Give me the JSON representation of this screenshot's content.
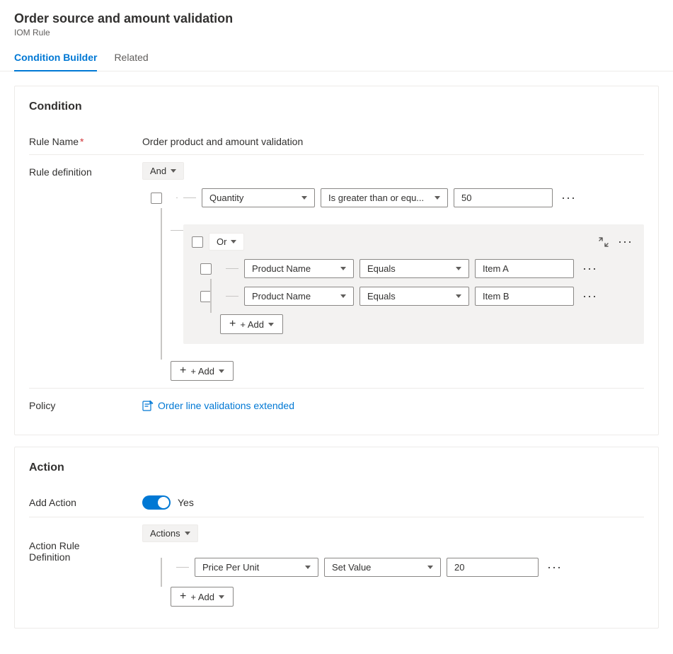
{
  "page": {
    "title": "Order source and amount validation",
    "subtitle": "IOM Rule"
  },
  "tabs": [
    {
      "id": "condition-builder",
      "label": "Condition Builder",
      "active": true
    },
    {
      "id": "related",
      "label": "Related",
      "active": false
    }
  ],
  "condition_section": {
    "title": "Condition",
    "rule_name_label": "Rule Name",
    "rule_name_value": "Order product and amount validation",
    "rule_definition_label": "Rule definition",
    "policy_label": "Policy",
    "policy_link_text": "Order line validations extended",
    "and_operator": "And",
    "or_operator": "Or",
    "quantity_field": "Quantity",
    "quantity_operator": "Is greater than or equ...",
    "quantity_value": "50",
    "product_name_1": "Product Name",
    "equals_1": "Equals",
    "item_a": "Item A",
    "product_name_2": "Product Name",
    "equals_2": "Equals",
    "item_b": "Item B",
    "add_inner": "+ Add",
    "add_outer": "+ Add"
  },
  "action_section": {
    "title": "Action",
    "add_action_label": "Add Action",
    "toggle_value": "Yes",
    "action_rule_label": "Action Rule\nDefinition",
    "actions_operator": "Actions",
    "price_per_unit": "Price Per Unit",
    "set_value": "Set Value",
    "value_20": "20",
    "add_btn": "+ Add"
  }
}
